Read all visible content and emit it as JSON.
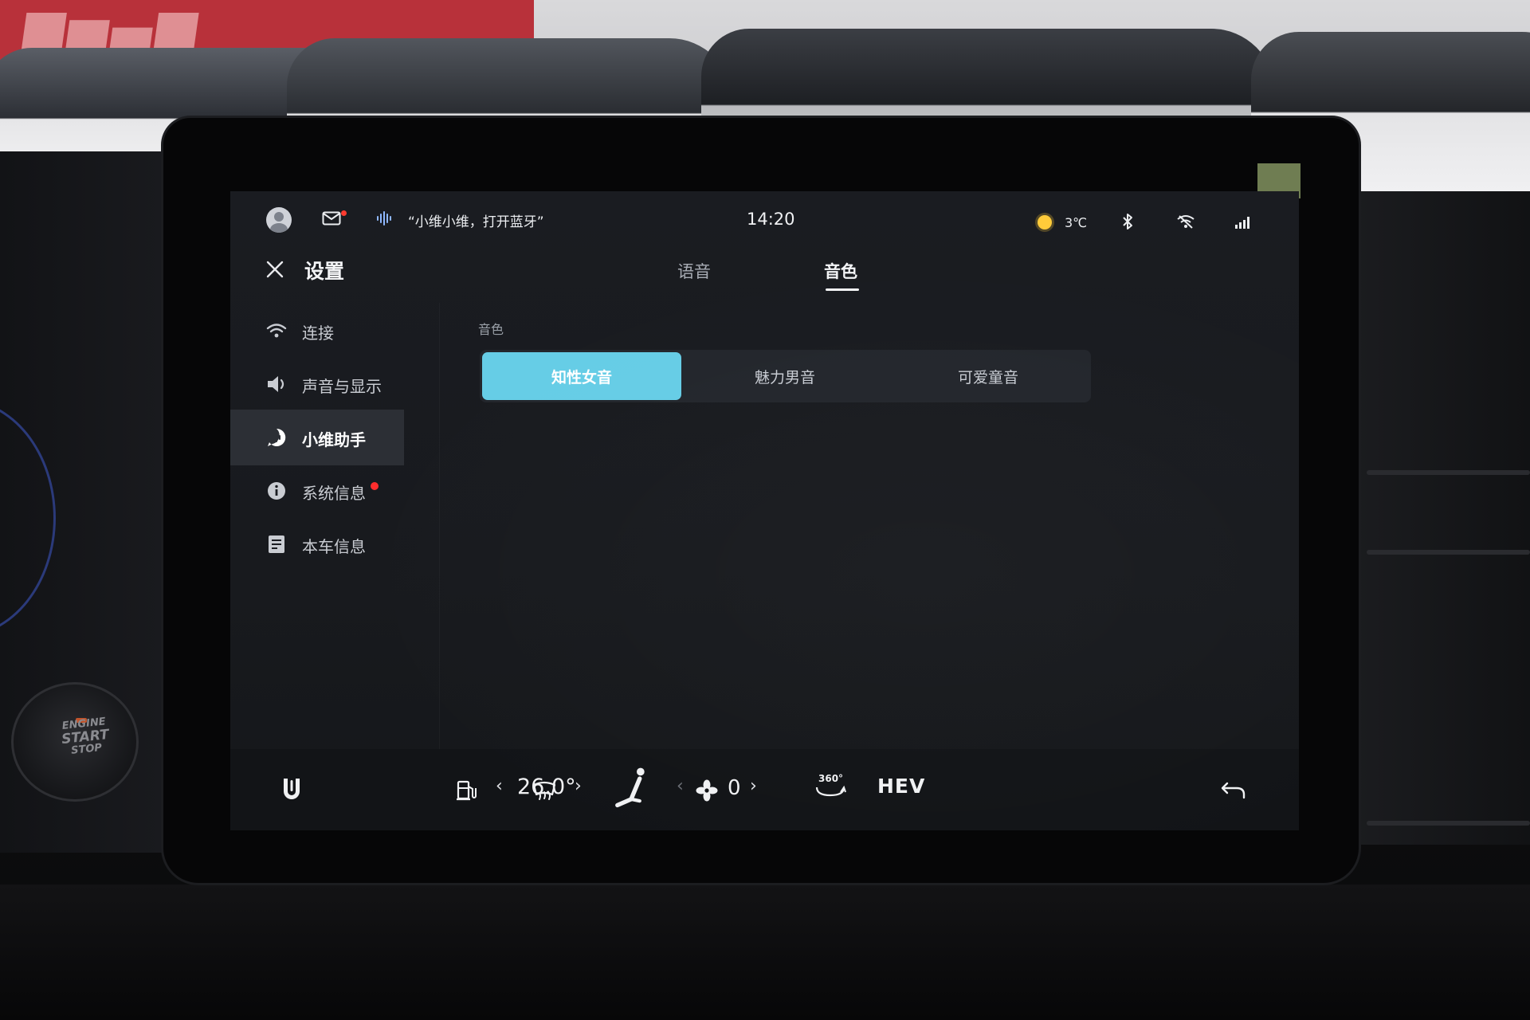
{
  "status_bar": {
    "voice_hint": "“小维小维，打开蓝牙”",
    "time": "14:20",
    "temperature": "3℃",
    "icons": [
      "avatar-icon",
      "mail-icon",
      "voice-wave-icon",
      "sun-icon",
      "bluetooth-icon",
      "wifi-off-icon",
      "signal-icon"
    ],
    "mail_unread": true
  },
  "header": {
    "title": "设置",
    "tabs": [
      {
        "label": "语音",
        "active": false
      },
      {
        "label": "音色",
        "active": true
      }
    ]
  },
  "sidebar": {
    "items": [
      {
        "label": "连接",
        "icon": "wifi-icon",
        "active": false,
        "badge": false
      },
      {
        "label": "声音与显示",
        "icon": "speaker-icon",
        "active": false,
        "badge": false
      },
      {
        "label": "小维助手",
        "icon": "assistant-icon",
        "active": true,
        "badge": false
      },
      {
        "label": "系统信息",
        "icon": "info-icon",
        "active": false,
        "badge": true
      },
      {
        "label": "本车信息",
        "icon": "document-icon",
        "active": false,
        "badge": false
      }
    ]
  },
  "content": {
    "section_label": "音色",
    "options": [
      {
        "label": "知性女音",
        "selected": true
      },
      {
        "label": "魅力男音",
        "selected": false
      },
      {
        "label": "可爱童音",
        "selected": false
      }
    ]
  },
  "dock": {
    "temperature": "26.0°",
    "fan_level": "0",
    "mode_label": "HEV",
    "camera_label": "360°",
    "icons": [
      "home-u-icon",
      "fuel-icon",
      "defrost-icon",
      "seat-icon",
      "fan-icon",
      "camera-360-icon",
      "back-icon"
    ]
  },
  "colors": {
    "accent": "#66cde6",
    "badge": "#ff2d2d",
    "screen_bg": "#1a1c21"
  },
  "scenery": {
    "start_button": [
      "ENGINE",
      "START",
      "STOP"
    ]
  }
}
